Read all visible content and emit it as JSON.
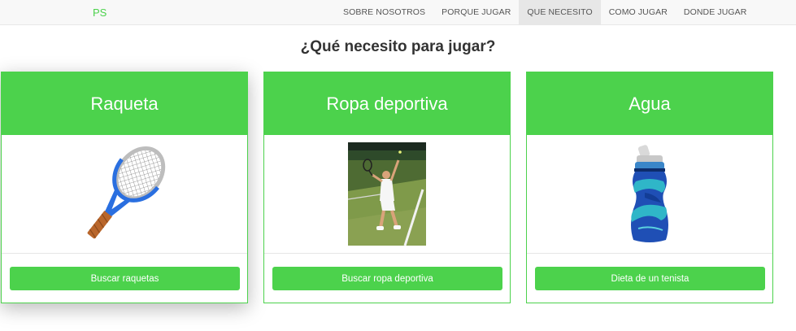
{
  "navbar": {
    "brand": "PS",
    "links": [
      {
        "label": "SOBRE NOSOTROS"
      },
      {
        "label": "PORQUE JUGAR"
      },
      {
        "label": "QUE NECESITO"
      },
      {
        "label": "COMO JUGAR"
      },
      {
        "label": "DONDE JUGAR"
      }
    ],
    "active_link": "QUE NECESITO"
  },
  "main": {
    "title": "¿Qué necesito para jugar?",
    "cards": [
      {
        "title": "Raqueta",
        "image_icon": "tennis-racket-icon",
        "button_label": "Buscar raquetas"
      },
      {
        "title": "Ropa deportiva",
        "image_icon": "tennis-player-photo",
        "button_label": "Buscar ropa deportiva"
      },
      {
        "title": "Agua",
        "image_icon": "water-bottle-icon",
        "button_label": "Dieta de un tenista"
      }
    ]
  },
  "colors": {
    "accent": "#4cd24c",
    "navbar_bg": "#f8f8f8",
    "active_nav_bg": "#e7e7e7"
  }
}
